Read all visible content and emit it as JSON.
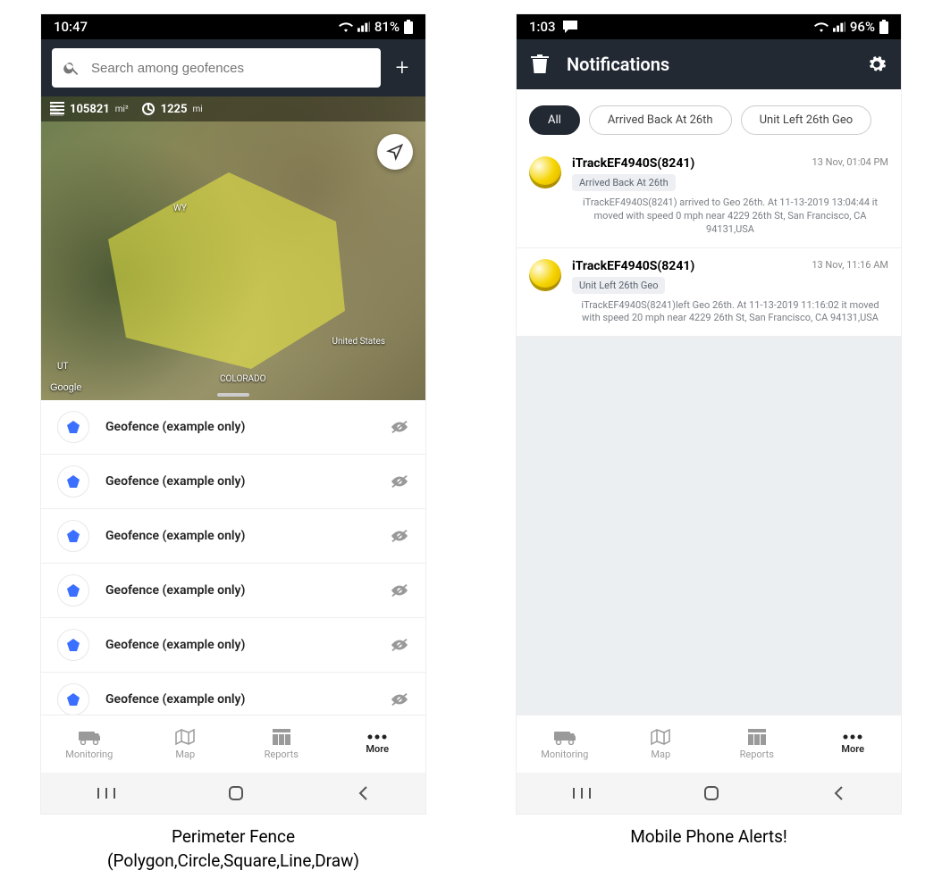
{
  "phone1": {
    "status": {
      "time": "10:47",
      "battery": "81%"
    },
    "search": {
      "placeholder": "Search among geofences"
    },
    "map": {
      "area_value": "105821",
      "area_unit": "mi²",
      "perimeter_value": "1225",
      "perimeter_unit": "mi",
      "label_wy": "WY",
      "label_ut": "UT",
      "label_us": "United States",
      "label_co": "COLORADO",
      "google": "Google"
    },
    "geofences": [
      {
        "label": "Geofence (example only)"
      },
      {
        "label": "Geofence (example only)"
      },
      {
        "label": "Geofence (example only)"
      },
      {
        "label": "Geofence (example only)"
      },
      {
        "label": "Geofence (example only)"
      },
      {
        "label": "Geofence (example only)"
      }
    ],
    "nav": {
      "monitoring": "Monitoring",
      "map": "Map",
      "reports": "Reports",
      "more": "More"
    },
    "caption_l1": "Perimeter Fence",
    "caption_l2": "(Polygon,Circle,Square,Line,Draw)"
  },
  "phone2": {
    "status": {
      "time": "1:03",
      "battery": "96%"
    },
    "header": {
      "title": "Notifications"
    },
    "filters": [
      {
        "label": "All",
        "active": true
      },
      {
        "label": "Arrived Back At 26th",
        "active": false
      },
      {
        "label": "Unit Left 26th Geo",
        "active": false
      }
    ],
    "items": [
      {
        "title": "iTrackEF4940S(8241)",
        "tag": "Arrived Back At 26th",
        "time": "13 Nov, 01:04 PM",
        "desc": "iTrackEF4940S(8241) arrived to Geo 26th.    At 11-13-2019 13:04:44 it moved with speed 0 mph near 4229 26th St, San Francisco, CA 94131,USA"
      },
      {
        "title": "iTrackEF4940S(8241)",
        "tag": "Unit Left 26th Geo",
        "time": "13 Nov, 11:16 AM",
        "desc": "iTrackEF4940S(8241)left Geo 26th.    At 11-13-2019 11:16:02 it moved with speed 20 mph near 4229 26th St, San Francisco, CA 94131,USA"
      }
    ],
    "nav": {
      "monitoring": "Monitoring",
      "map": "Map",
      "reports": "Reports",
      "more": "More"
    },
    "caption": "Mobile Phone Alerts!"
  }
}
